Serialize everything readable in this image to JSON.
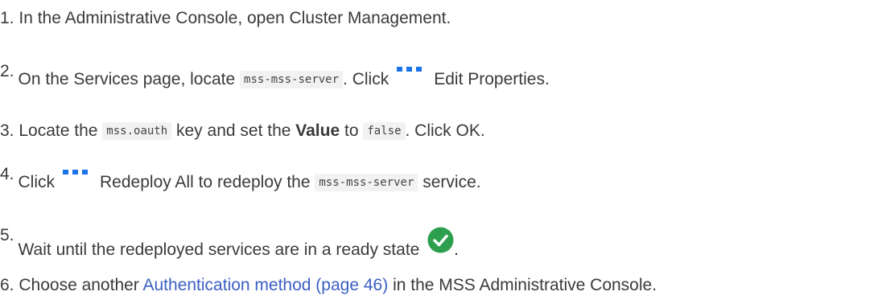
{
  "steps": [
    {
      "number": "1.",
      "text": "In the Administrative Console, open Cluster Management."
    },
    {
      "number": "2.",
      "before": "On the Services page, locate",
      "code": "mss-mss-server",
      "middle": ". Click",
      "after": "Edit Properties."
    },
    {
      "number": "3.",
      "before": "Locate the",
      "code1": "mss.oauth",
      "middle1": "key and set the",
      "bold": "Value",
      "middle2": "to",
      "code2": "false",
      "after": ". Click OK."
    },
    {
      "number": "4.",
      "before": "Click",
      "middle": "Redeploy All to redeploy the",
      "code": "mss-mss-server",
      "after": "service."
    },
    {
      "number": "5.",
      "text": "Wait until the redeployed services are in a ready state",
      "after": "."
    },
    {
      "number": "6.",
      "before": "Choose another",
      "link": "Authentication method (page 46)",
      "after": "in the MSS Administrative Console."
    }
  ],
  "icons": {
    "more": "more-options-icon",
    "ready": "check-circle-icon"
  },
  "colors": {
    "text": "#3a3a3a",
    "link": "#3b5fc4",
    "dots": "#1a73e8",
    "check": "#2e9f4f",
    "code_bg": "#f2f2f2"
  }
}
